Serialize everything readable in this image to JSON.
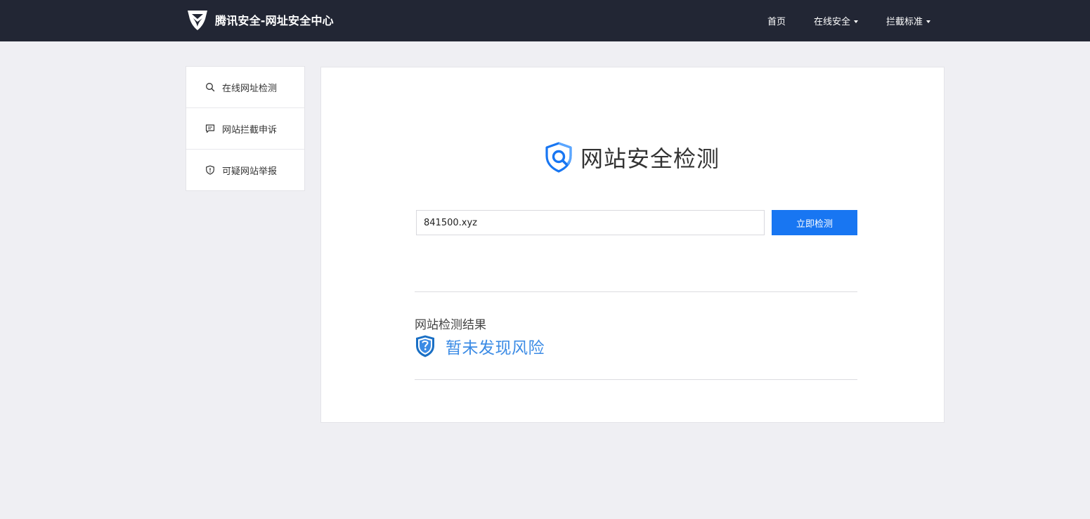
{
  "header": {
    "brand_title": "腾讯安全-网址安全中心",
    "logo_icon": "tencent-security-logo-icon",
    "nav": [
      {
        "label": "首页",
        "dropdown": false
      },
      {
        "label": "在线安全",
        "dropdown": true
      },
      {
        "label": "拦截标准",
        "dropdown": true
      }
    ]
  },
  "sidebar": {
    "items": [
      {
        "label": "在线网址检测",
        "icon": "search-icon"
      },
      {
        "label": "网站拦截申诉",
        "icon": "chat-icon"
      },
      {
        "label": "可疑网站举报",
        "icon": "shield-alert-icon"
      }
    ]
  },
  "main": {
    "title": "网站安全检测",
    "title_icon": "shield-search-icon",
    "search": {
      "value": "841500.xyz",
      "button_label": "立即检测"
    },
    "result": {
      "heading": "网站检测结果",
      "status_text": "暂未发现风险",
      "status_icon": "shield-question-icon"
    }
  },
  "colors": {
    "header_bg": "#222634",
    "page_bg": "#efeff3",
    "accent": "#1876f2",
    "result_text": "#3b8be5"
  }
}
